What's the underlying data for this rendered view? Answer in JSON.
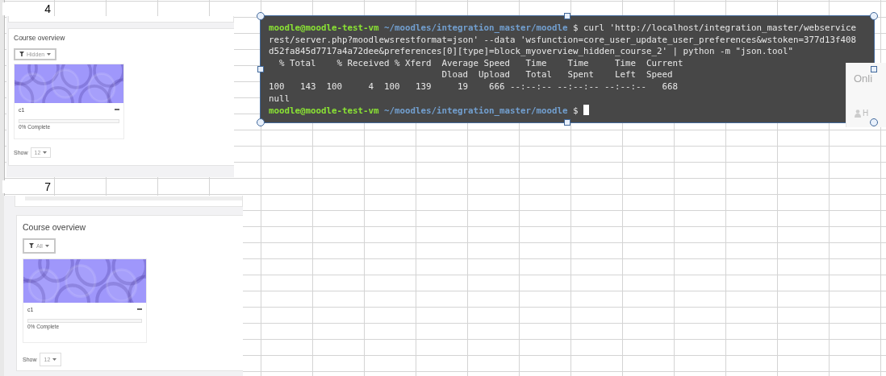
{
  "sheet": {
    "row_labels": [
      {
        "text": "4"
      },
      {
        "text": "7"
      }
    ]
  },
  "screenshots": [
    {
      "filter": "Hidden",
      "title": "Course overview",
      "course": {
        "name": "c1",
        "progress_text": "0% Complete",
        "level": 0
      },
      "show_label": "Show",
      "show_value": "12"
    },
    {
      "filter": "All",
      "title": "Course overview",
      "course": {
        "name": "c1",
        "progress_text": "0% Complete",
        "level": 0
      },
      "show_label": "Show",
      "show_value": "12"
    }
  ],
  "background_panel": {
    "text": "Onli",
    "user_text": "H"
  },
  "terminal": {
    "selected": true,
    "lines": [
      {
        "kind": "prompt",
        "user": "moodle@moodle-test-vm",
        "path": "~/moodles/integration_master/moodle",
        "command": "$ curl 'http://localhost/integration_master/webservice"
      },
      {
        "kind": "output",
        "text": "rest/server.php?moodlewsrestformat=json' --data 'wsfunction=core_user_update_user_preferences&wstoken=377d13f408"
      },
      {
        "kind": "output",
        "text": "d52fa845d7717a4a72dee&preferences[0][type]=block_myoverview_hidden_course_2' | python -m \"json.tool\""
      },
      {
        "kind": "output",
        "text": "  % Total    % Received % Xferd  Average Speed   Time    Time     Time  Current"
      },
      {
        "kind": "output",
        "text": "                                 Dload  Upload   Total   Spent    Left  Speed"
      },
      {
        "kind": "output",
        "text": "100   143  100     4  100   139     19    666 --:--:-- --:--:-- --:--:--   668"
      },
      {
        "kind": "output",
        "text": "null"
      },
      {
        "kind": "cursor",
        "user": "moodle@moodle-test-vm",
        "path": "~/moodles/integration_master/moodle",
        "command": "$"
      }
    ]
  }
}
